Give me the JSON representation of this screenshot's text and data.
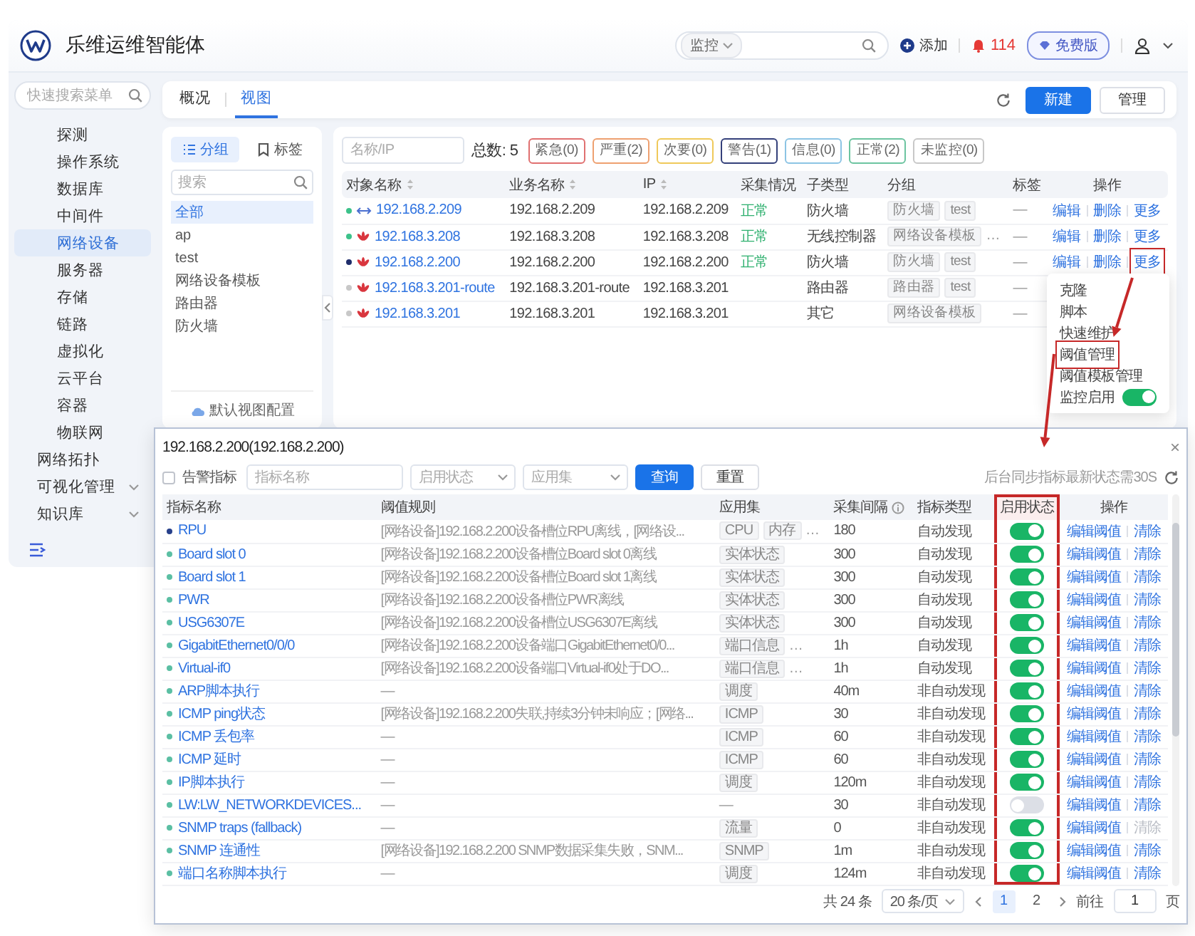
{
  "header": {
    "product": "乐维运维智能体",
    "search": {
      "scope": "监控"
    },
    "add": "添加",
    "alert_count": "114",
    "plan": "免费版"
  },
  "sidebar": {
    "search_placeholder": "快速搜索菜单",
    "items": [
      {
        "label": "探测",
        "kind": "sub",
        "selected": false
      },
      {
        "label": "操作系统",
        "kind": "sub",
        "selected": false
      },
      {
        "label": "数据库",
        "kind": "sub",
        "selected": false
      },
      {
        "label": "中间件",
        "kind": "sub",
        "selected": false
      },
      {
        "label": "网络设备",
        "kind": "sub",
        "selected": true
      },
      {
        "label": "服务器",
        "kind": "sub",
        "selected": false
      },
      {
        "label": "存储",
        "kind": "sub",
        "selected": false
      },
      {
        "label": "链路",
        "kind": "sub",
        "selected": false
      },
      {
        "label": "虚拟化",
        "kind": "sub",
        "selected": false
      },
      {
        "label": "云平台",
        "kind": "sub",
        "selected": false
      },
      {
        "label": "容器",
        "kind": "sub",
        "selected": false
      },
      {
        "label": "物联网",
        "kind": "sub",
        "selected": false
      },
      {
        "label": "网络拓扑",
        "kind": "top",
        "selected": false
      },
      {
        "label": "可视化管理",
        "kind": "top",
        "selected": false,
        "expanded": false
      },
      {
        "label": "知识库",
        "kind": "top",
        "selected": false,
        "expanded": false
      }
    ]
  },
  "tabs": [
    {
      "label": "概况",
      "selected": false
    },
    {
      "label": "视图",
      "selected": true
    }
  ],
  "toolbar": {
    "primary": "新建",
    "secondary": "管理"
  },
  "group_panel": {
    "tabs": [
      {
        "label": "分组",
        "kind": "list",
        "selected": true
      },
      {
        "label": "标签",
        "kind": "tag",
        "selected": false
      }
    ],
    "search_placeholder": "搜索",
    "items": [
      {
        "label": "全部",
        "selected": true
      },
      {
        "label": "ap",
        "selected": false
      },
      {
        "label": "test",
        "selected": false
      },
      {
        "label": "网络设备模板",
        "selected": false
      },
      {
        "label": "路由器",
        "selected": false
      },
      {
        "label": "防火墙",
        "selected": false
      }
    ],
    "footer": "默认视图配置"
  },
  "objects": {
    "search_placeholder": "名称/IP",
    "total": "总数: 5",
    "filters": [
      {
        "label": "紧急(0)",
        "color": "#e07070"
      },
      {
        "label": "严重(2)",
        "color": "#eea070"
      },
      {
        "label": "次要(0)",
        "color": "#efc95a"
      },
      {
        "label": "警告(1)",
        "color": "#34407a"
      },
      {
        "label": "信息(0)",
        "color": "#8cc4e4"
      },
      {
        "label": "正常(2)",
        "color": "#6cc4a0"
      },
      {
        "label": "未监控(0)",
        "color": "#c8c8c8"
      }
    ],
    "columns": [
      {
        "label": "对象名称",
        "sortable": true
      },
      {
        "label": "业务名称",
        "sortable": true
      },
      {
        "label": "IP",
        "sortable": true
      },
      {
        "label": "采集情况",
        "sortable": false
      },
      {
        "label": "子类型",
        "sortable": false
      },
      {
        "label": "分组",
        "sortable": false
      },
      {
        "label": "标签",
        "sortable": false
      },
      {
        "label": "操作",
        "sortable": false
      }
    ],
    "rows": [
      {
        "color": "#3cc28a",
        "kind": "link",
        "name": "192.168.2.209",
        "business": "192.168.2.209",
        "ip": "192.168.2.209",
        "collect": "正常",
        "subtype": "防火墙",
        "groups": [
          "防火墙",
          "test"
        ],
        "label": "—",
        "actions": [
          {
            "label": "编辑",
            "highlighted": false
          },
          {
            "label": "删除",
            "highlighted": false
          },
          {
            "label": "更多",
            "highlighted": false
          }
        ]
      },
      {
        "color": "#3cc28a",
        "kind": "device",
        "name": "192.168.3.208",
        "business": "192.168.3.208",
        "ip": "192.168.3.208",
        "collect": "正常",
        "subtype": "无线控制器",
        "groups": [
          "网络设备模板"
        ],
        "groups_more": "…",
        "label": "—",
        "actions": [
          {
            "label": "编辑",
            "highlighted": false
          },
          {
            "label": "删除",
            "highlighted": false
          },
          {
            "label": "更多",
            "highlighted": false
          }
        ]
      },
      {
        "color": "#1f2d6b",
        "kind": "device",
        "name": "192.168.2.200",
        "business": "192.168.2.200",
        "ip": "192.168.2.200",
        "collect": "正常",
        "subtype": "防火墙",
        "groups": [
          "防火墙",
          "test"
        ],
        "label": "—",
        "actions": [
          {
            "label": "编辑",
            "highlighted": false
          },
          {
            "label": "删除",
            "highlighted": false
          },
          {
            "label": "更多",
            "highlighted": true
          }
        ],
        "menu": [
          {
            "label": "克隆",
            "kind": "action",
            "highlighted": false
          },
          {
            "label": "脚本",
            "kind": "action",
            "highlighted": false
          },
          {
            "label": "快速维护",
            "kind": "action",
            "highlighted": false
          },
          {
            "label": "阈值管理",
            "kind": "action",
            "highlighted": true
          },
          {
            "label": "阈值模板管理",
            "kind": "action",
            "highlighted": false
          },
          {
            "label": "监控启用",
            "kind": "toggle",
            "on": true,
            "highlighted": false
          }
        ]
      },
      {
        "color": "#c8c8c8",
        "kind": "device",
        "name": "192.168.3.201-route",
        "business": "192.168.3.201-route",
        "ip": "192.168.3.201",
        "subtype": "路由器",
        "groups": [
          "路由器",
          "test"
        ],
        "label": "—"
      },
      {
        "color": "#c8c8c8",
        "kind": "device",
        "name": "192.168.3.201",
        "business": "192.168.3.201",
        "ip": "192.168.3.201",
        "subtype": "其它",
        "groups": [
          "网络设备模板"
        ],
        "label": "—"
      }
    ]
  },
  "dialog": {
    "title": "192.168.2.200(192.168.2.200)",
    "close": "×",
    "filters": {
      "alarm_only": {
        "label": "告警指标",
        "checked": false
      },
      "name_placeholder": "指标名称",
      "status_placeholder": "启用状态",
      "appset_placeholder": "应用集",
      "query": "查询",
      "reset": "重置",
      "sync_note": "后台同步指标最新状态需30S"
    },
    "columns": [
      {
        "label": "指标名称",
        "highlighted": false
      },
      {
        "label": "阈值规则",
        "highlighted": false
      },
      {
        "label": "应用集",
        "highlighted": false
      },
      {
        "label": "采集间隔",
        "info": true,
        "highlighted": false
      },
      {
        "label": "指标类型",
        "highlighted": false
      },
      {
        "label": "启用状态",
        "highlighted": true
      },
      {
        "label": "操作",
        "highlighted": false
      }
    ],
    "rows": [
      {
        "color": "#27408b",
        "name": "RPU",
        "rule": "[网络设备]192.168.2.200设备槽位RPU离线，[网络设...",
        "tags": [
          "CPU",
          "内存"
        ],
        "tags_more": "…",
        "interval": "180",
        "type": "自动发现",
        "enabled": true,
        "actions": [
          {
            "label": "编辑阈值",
            "disabled": false
          },
          {
            "label": "清除",
            "disabled": false
          }
        ]
      },
      {
        "color": "#5bbfa3",
        "name": "Board slot 0",
        "rule": "[网络设备]192.168.2.200设备槽位Board slot 0离线",
        "tags": [
          "实体状态"
        ],
        "interval": "300",
        "type": "自动发现",
        "enabled": true,
        "actions": [
          {
            "label": "编辑阈值",
            "disabled": false
          },
          {
            "label": "清除",
            "disabled": false
          }
        ]
      },
      {
        "color": "#5bbfa3",
        "name": "Board slot 1",
        "rule": "[网络设备]192.168.2.200设备槽位Board slot 1离线",
        "tags": [
          "实体状态"
        ],
        "interval": "300",
        "type": "自动发现",
        "enabled": true,
        "actions": [
          {
            "label": "编辑阈值",
            "disabled": false
          },
          {
            "label": "清除",
            "disabled": false
          }
        ]
      },
      {
        "color": "#5bbfa3",
        "name": "PWR",
        "rule": "[网络设备]192.168.2.200设备槽位PWR离线",
        "tags": [
          "实体状态"
        ],
        "interval": "300",
        "type": "自动发现",
        "enabled": true,
        "actions": [
          {
            "label": "编辑阈值",
            "disabled": false
          },
          {
            "label": "清除",
            "disabled": false
          }
        ]
      },
      {
        "color": "#5bbfa3",
        "name": "USG6307E",
        "rule": "[网络设备]192.168.2.200设备槽位USG6307E离线",
        "tags": [
          "实体状态"
        ],
        "interval": "300",
        "type": "自动发现",
        "enabled": true,
        "actions": [
          {
            "label": "编辑阈值",
            "disabled": false
          },
          {
            "label": "清除",
            "disabled": false
          }
        ]
      },
      {
        "color": "#5bbfa3",
        "name": "GigabitEthernet0/0/0",
        "rule": "[网络设备]192.168.2.200设备端口GigabitEthernet0/0...",
        "tags": [
          "端口信息"
        ],
        "tags_more": "…",
        "interval": "1h",
        "type": "自动发现",
        "enabled": true,
        "actions": [
          {
            "label": "编辑阈值",
            "disabled": false
          },
          {
            "label": "清除",
            "disabled": false
          }
        ]
      },
      {
        "color": "#5bbfa3",
        "name": "Virtual-if0",
        "rule": "[网络设备]192.168.2.200设备端口Virtual-if0处于DO...",
        "tags": [
          "端口信息"
        ],
        "tags_more": "…",
        "interval": "1h",
        "type": "自动发现",
        "enabled": true,
        "actions": [
          {
            "label": "编辑阈值",
            "disabled": false
          },
          {
            "label": "清除",
            "disabled": false
          }
        ]
      },
      {
        "color": "#5bbfa3",
        "name": "ARP脚本执行",
        "rule": "—",
        "tags": [
          "调度"
        ],
        "interval": "40m",
        "type": "非自动发现",
        "enabled": true,
        "actions": [
          {
            "label": "编辑阈值",
            "disabled": false
          },
          {
            "label": "清除",
            "disabled": false
          }
        ]
      },
      {
        "color": "#5bbfa3",
        "name": "ICMP ping状态",
        "rule": "[网络设备]192.168.2.200失联,持续3分钟未响应；[网络...",
        "tags": [
          "ICMP"
        ],
        "interval": "30",
        "type": "非自动发现",
        "enabled": true,
        "actions": [
          {
            "label": "编辑阈值",
            "disabled": false
          },
          {
            "label": "清除",
            "disabled": false
          }
        ]
      },
      {
        "color": "#5bbfa3",
        "name": "ICMP 丢包率",
        "rule": "—",
        "tags": [
          "ICMP"
        ],
        "interval": "60",
        "type": "非自动发现",
        "enabled": true,
        "actions": [
          {
            "label": "编辑阈值",
            "disabled": false
          },
          {
            "label": "清除",
            "disabled": false
          }
        ]
      },
      {
        "color": "#5bbfa3",
        "name": "ICMP 延时",
        "rule": "—",
        "tags": [
          "ICMP"
        ],
        "interval": "60",
        "type": "非自动发现",
        "enabled": true,
        "actions": [
          {
            "label": "编辑阈值",
            "disabled": false
          },
          {
            "label": "清除",
            "disabled": false
          }
        ]
      },
      {
        "color": "#5bbfa3",
        "name": "IP脚本执行",
        "rule": "—",
        "tags": [
          "调度"
        ],
        "interval": "120m",
        "type": "非自动发现",
        "enabled": true,
        "actions": [
          {
            "label": "编辑阈值",
            "disabled": false
          },
          {
            "label": "清除",
            "disabled": false
          }
        ]
      },
      {
        "color": "#5bbfa3",
        "name": "LW:LW_NETWORKDEVICES...",
        "rule": "—",
        "tags_empty": "—",
        "interval": "30",
        "type": "非自动发现",
        "enabled": false,
        "actions": [
          {
            "label": "编辑阈值",
            "disabled": false
          },
          {
            "label": "清除",
            "disabled": false
          }
        ]
      },
      {
        "color": "#5bbfa3",
        "name": "SNMP traps (fallback)",
        "rule": "—",
        "tags": [
          "流量"
        ],
        "interval": "0",
        "type": "非自动发现",
        "enabled": true,
        "actions": [
          {
            "label": "编辑阈值",
            "disabled": false
          },
          {
            "label": "清除",
            "disabled": true
          }
        ]
      },
      {
        "color": "#5bbfa3",
        "name": "SNMP 连通性",
        "rule": "[网络设备]192.168.2.200 SNMP数据采集失败，SNM...",
        "tags": [
          "SNMP"
        ],
        "interval": "1m",
        "type": "非自动发现",
        "enabled": true,
        "actions": [
          {
            "label": "编辑阈值",
            "disabled": false
          },
          {
            "label": "清除",
            "disabled": false
          }
        ]
      },
      {
        "color": "#5bbfa3",
        "name": "端口名称脚本执行",
        "rule": "—",
        "tags": [
          "调度"
        ],
        "interval": "124m",
        "type": "非自动发现",
        "enabled": true,
        "actions": [
          {
            "label": "编辑阈值",
            "disabled": false
          },
          {
            "label": "清除",
            "disabled": false
          }
        ]
      }
    ],
    "pagination": {
      "total": "共 24 条",
      "page_size": "20 条/页",
      "pages": [
        {
          "label": "1",
          "selected": true
        },
        {
          "label": "2",
          "selected": false
        }
      ],
      "goto": "前往",
      "goto_value": "1",
      "unit": "页"
    }
  }
}
